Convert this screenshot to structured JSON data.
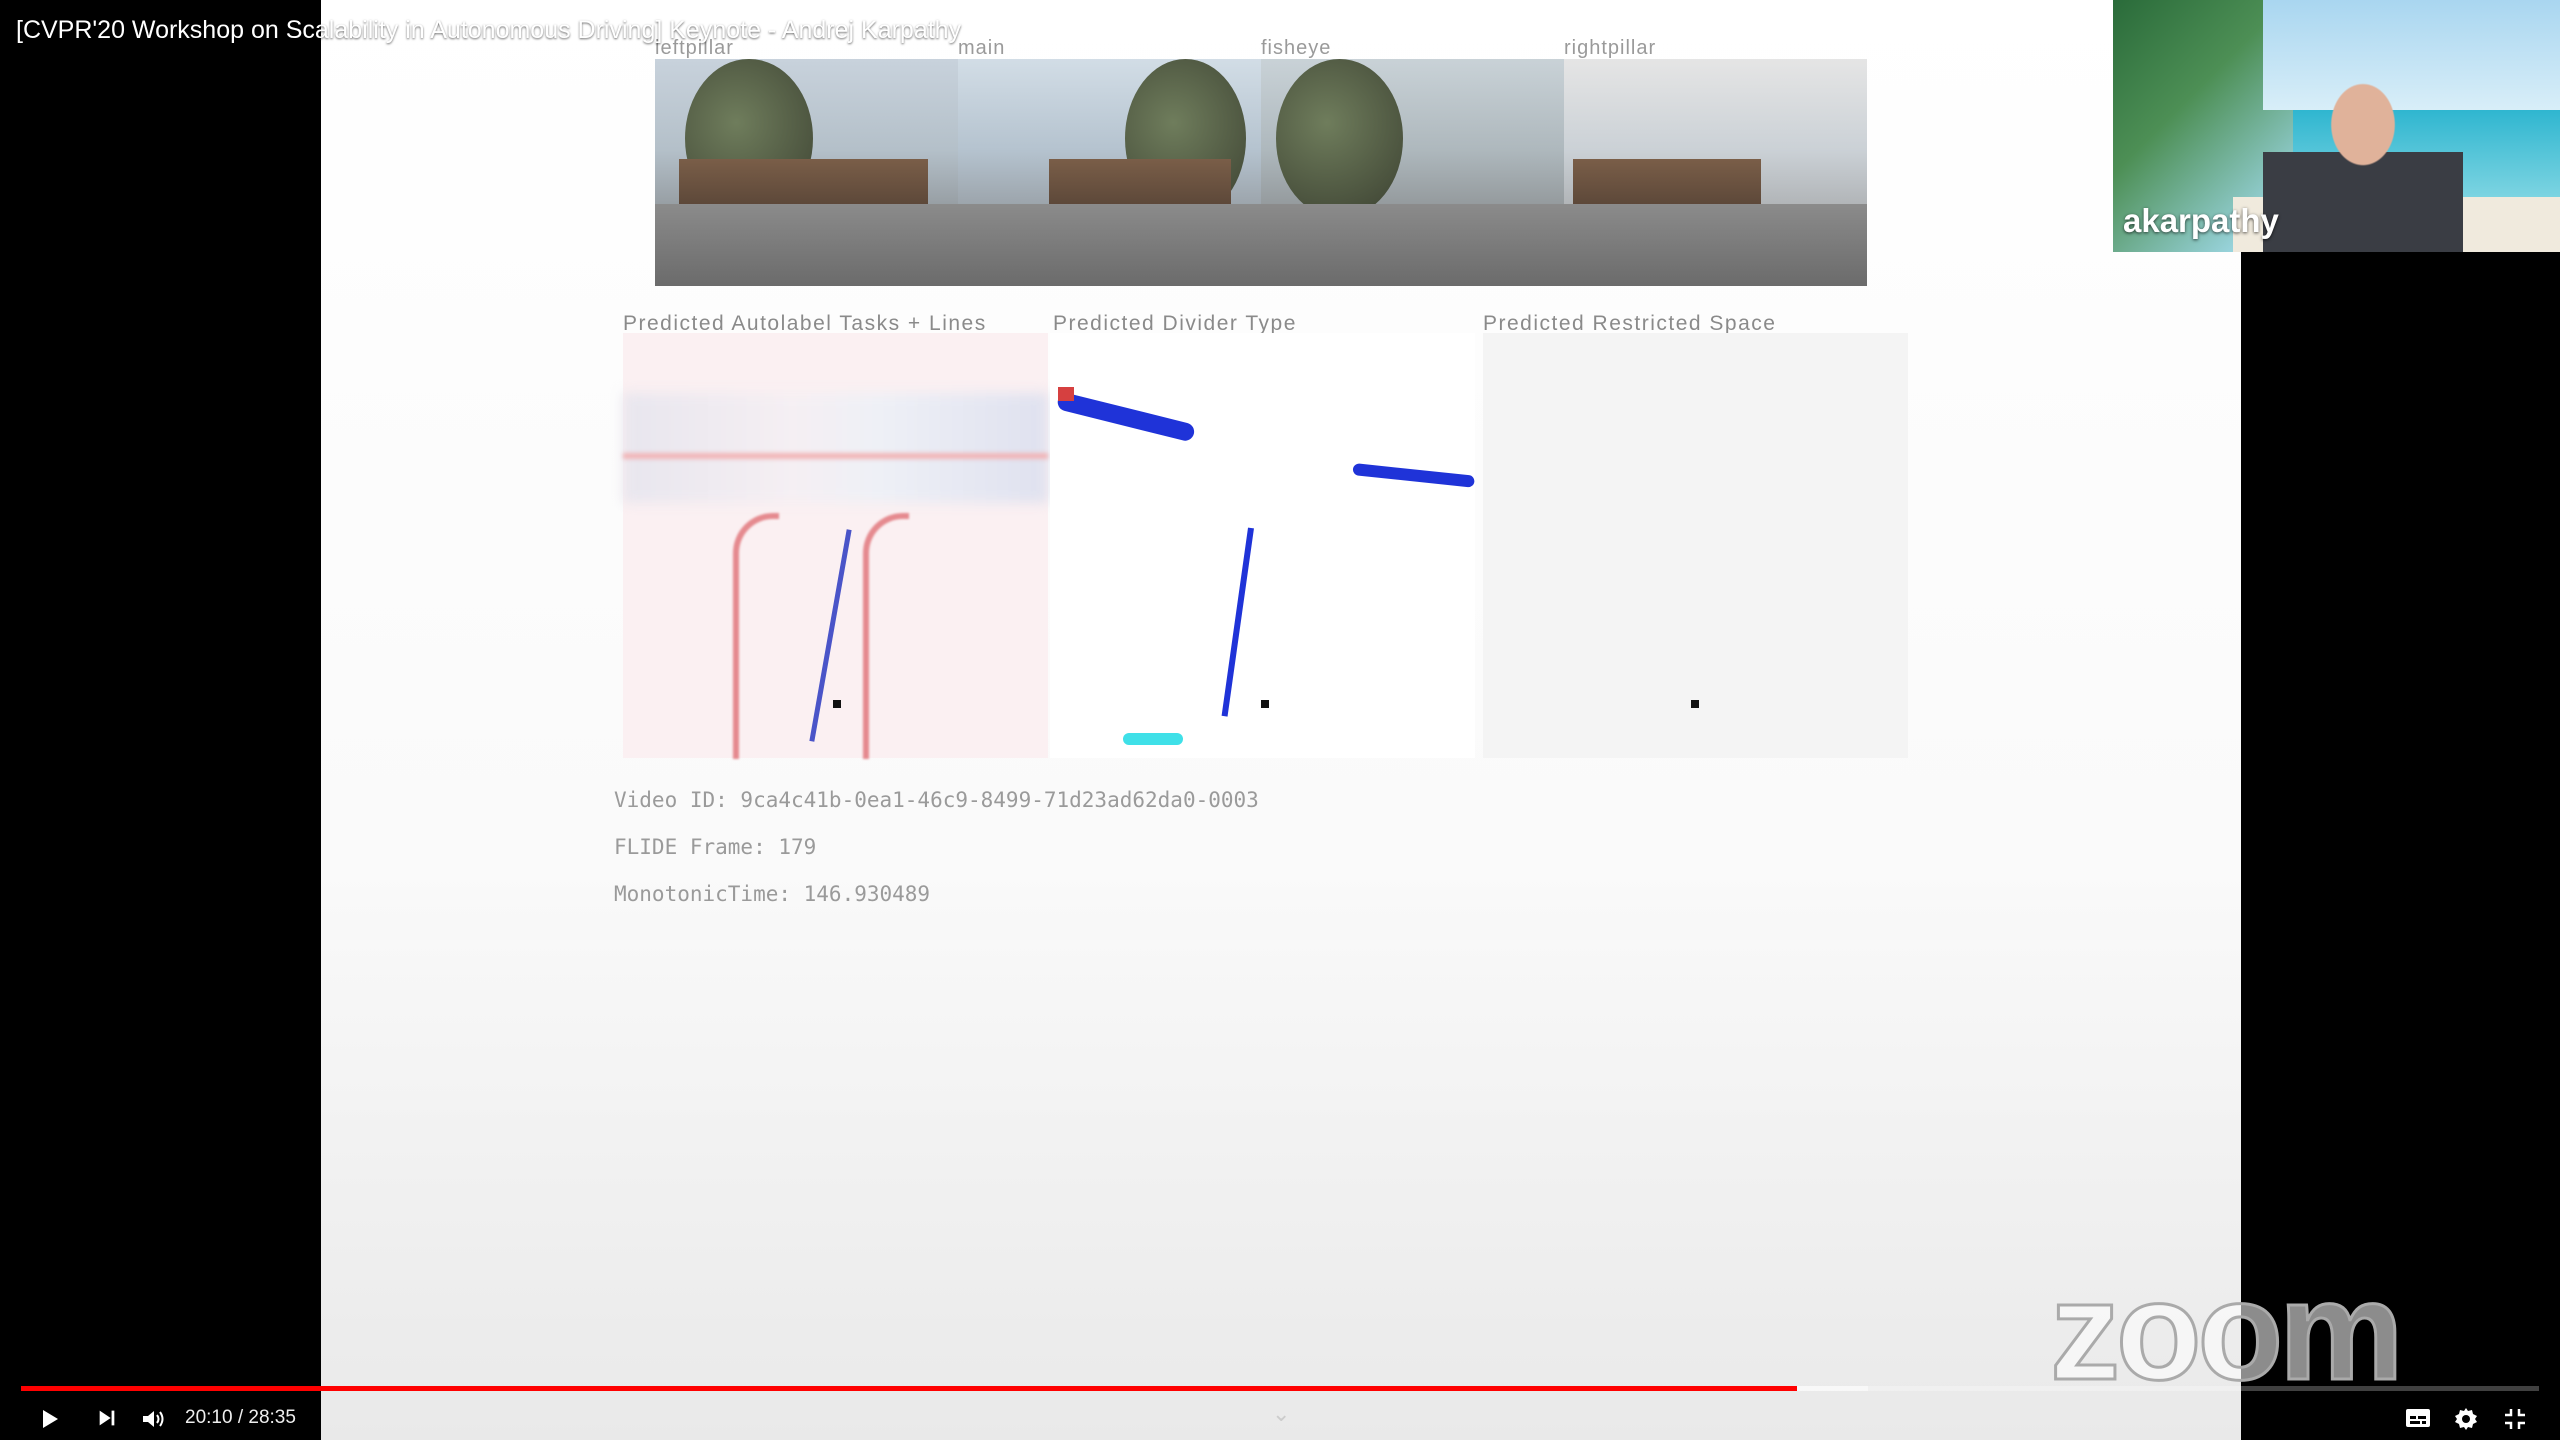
{
  "video": {
    "title": "[CVPR'20 Workshop on Scalability in Autonomous Driving] Keynote - Andrej Karpathy",
    "current_time": "20:10",
    "duration": "28:35",
    "time_display": "20:10 / 28:35",
    "progress_fraction": 0.7055,
    "buffered_fraction": 0.7335
  },
  "slide": {
    "camera_labels": [
      "leftpillar",
      "main",
      "fisheye",
      "rightpillar"
    ],
    "panel_titles": [
      "Predicted Autolabel Tasks + Lines",
      "Predicted Divider Type",
      "Predicted Restricted Space"
    ],
    "video_id": "Video ID: 9ca4c41b-0ea1-46c9-8499-71d23ad62da0-0003",
    "flide_frame": "FLIDE Frame: 179",
    "monotonic_time": "MonotonicTime: 146.930489"
  },
  "participant": {
    "name": "akarpathy"
  },
  "branding": {
    "zoom_logo": "zoom"
  },
  "colors": {
    "progress": "#ff0000"
  },
  "icons": {
    "play": "play-icon",
    "next": "next-icon",
    "volume": "volume-icon",
    "captions": "captions-icon",
    "settings": "gear-icon",
    "exit_fullscreen": "exit-fullscreen-icon",
    "chevron": "chevron-down-icon"
  }
}
